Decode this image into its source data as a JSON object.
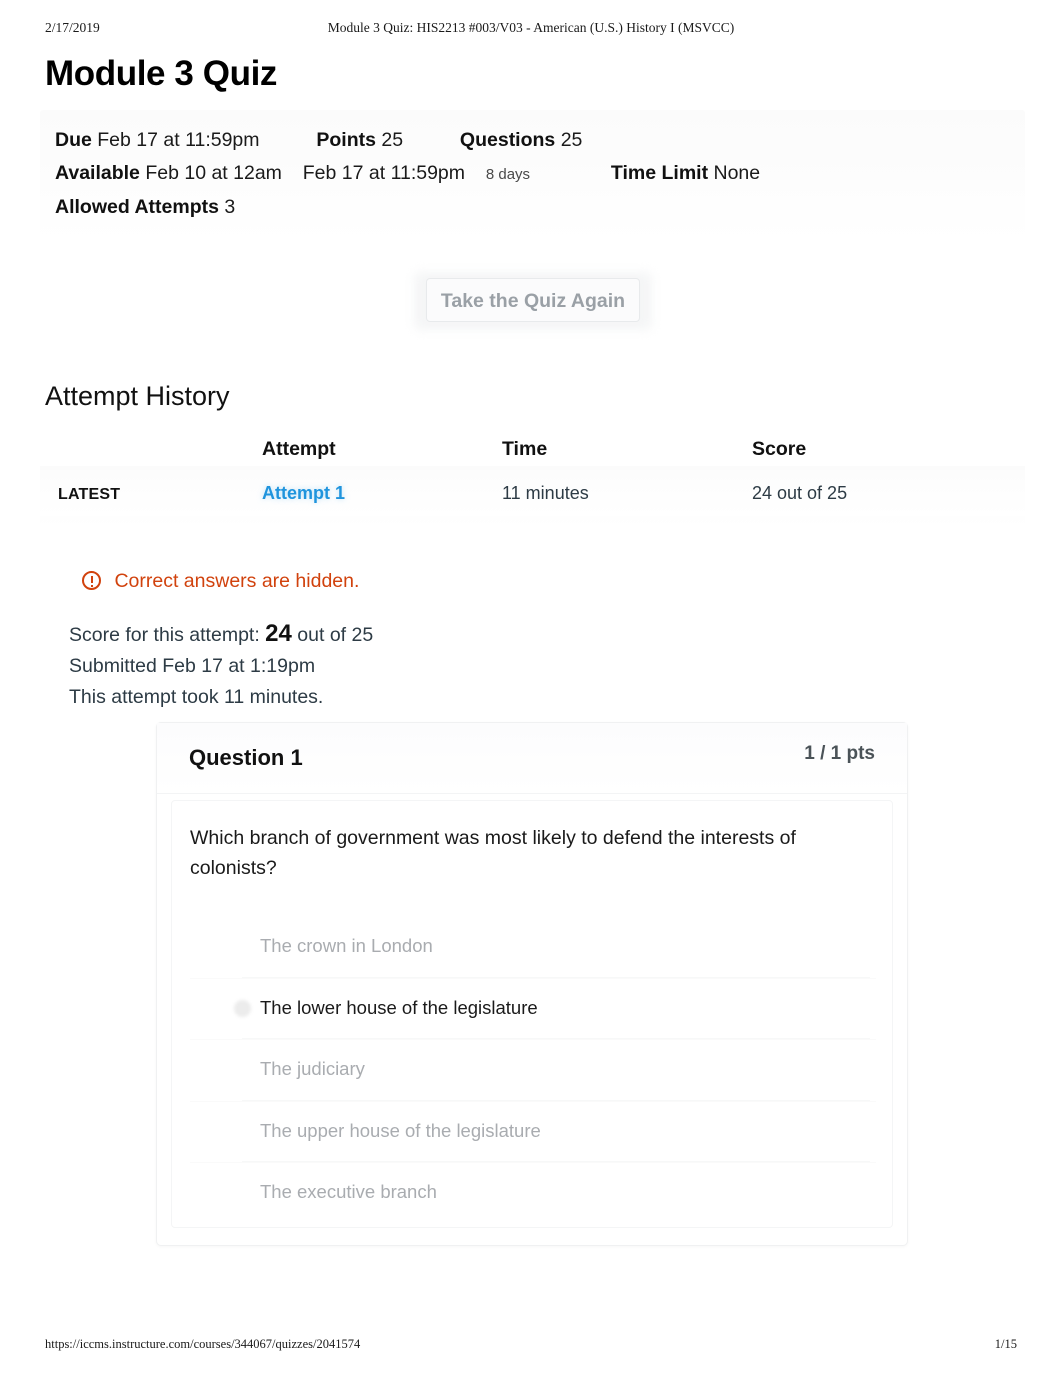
{
  "print": {
    "date": "2/17/2019",
    "doc_title": "Module 3 Quiz: HIS2213 #003/V03 - American (U.S.) History I (MSVCC)",
    "url": "https://iccms.instructure.com/courses/344067/quizzes/2041574",
    "page": "1/15"
  },
  "page_title": "Module 3 Quiz",
  "quiz_meta": {
    "due_label": "Due",
    "due_value": "Feb 17 at 11:59pm",
    "points_label": "Points",
    "points_value": "25",
    "questions_label": "Questions",
    "questions_value": "25",
    "available_label": "Available",
    "available_from": "Feb 10 at 12am",
    "available_to": "Feb 17 at 11:59pm",
    "available_duration": "8 days",
    "time_limit_label": "Time Limit",
    "time_limit_value": "None",
    "attempts_label": "Allowed Attempts",
    "attempts_value": "3"
  },
  "take_again_button": "Take the Quiz Again",
  "attempt_history": {
    "heading": "Attempt History",
    "columns": [
      "",
      "Attempt",
      "Time",
      "Score"
    ],
    "rows": [
      {
        "badge": "LATEST",
        "attempt": "Attempt 1",
        "time": "11 minutes",
        "score": "24 out of 25"
      }
    ]
  },
  "warning": {
    "text": "Correct answers are hidden.",
    "color": "#d1420d"
  },
  "score_summary": {
    "line1_prefix": "Score for this attempt:",
    "line1_score": "24",
    "line1_suffix": "out of 25",
    "line2": "Submitted Feb 17 at 1:19pm",
    "line3": "This attempt took 11 minutes."
  },
  "question": {
    "name": "Question 1",
    "points": "1 / 1 pts",
    "text": "Which branch of government was most likely to defend the interests of colonists?",
    "answers": [
      {
        "text": "The crown in London",
        "selected": false
      },
      {
        "text": "The lower house of the legislature",
        "selected": true
      },
      {
        "text": "The judiciary",
        "selected": false
      },
      {
        "text": "The upper house of the legislature",
        "selected": false
      },
      {
        "text": "The executive branch",
        "selected": false
      }
    ]
  },
  "colors": {
    "link_blue": "#1f94dd",
    "warning_orange": "#d1420d",
    "text_dark": "#1a1a1a",
    "text_muted": "#a9acb0"
  }
}
